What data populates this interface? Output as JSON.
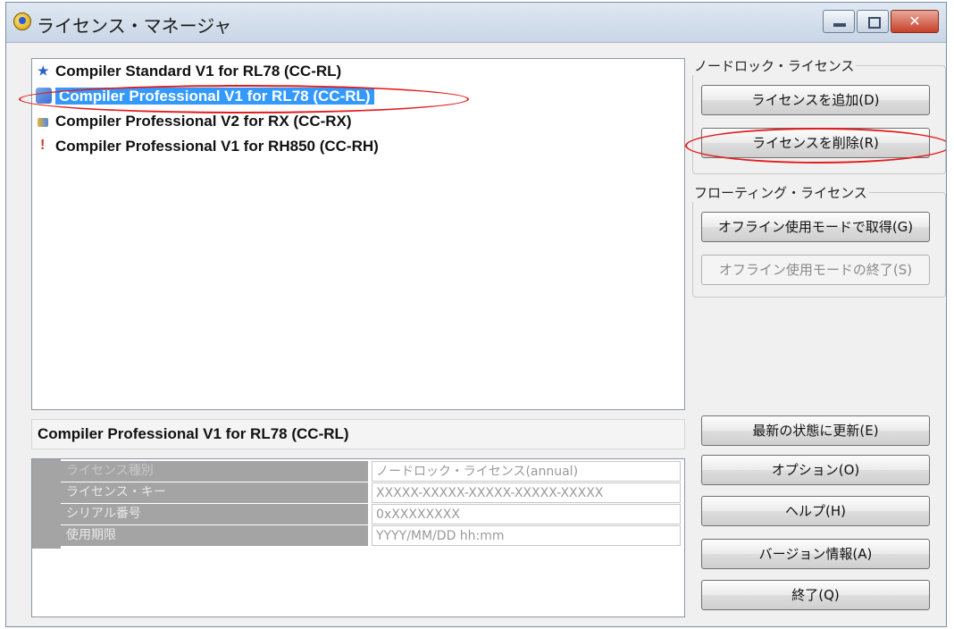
{
  "window": {
    "title": "ライセンス・マネージャ",
    "close_label": "✕"
  },
  "license_list": [
    {
      "label": "Compiler Standard V1 for RL78 (CC-RL)",
      "icon": "star-icon"
    },
    {
      "label": "Compiler Professional V1 for RL78 (CC-RL)",
      "icon": "key-icon",
      "selected": true
    },
    {
      "label": "Compiler Professional V2 for RX (CC-RX)",
      "icon": "license-icon"
    },
    {
      "label": "Compiler Professional V1 for RH850 (CC-RH)",
      "icon": "warning-icon"
    }
  ],
  "node_lock": {
    "group_label": "ノードロック・ライセンス",
    "add_label": "ライセンスを追加(D)",
    "remove_label": "ライセンスを削除(R)"
  },
  "floating": {
    "group_label": "フローティング・ライセンス",
    "offline_acquire_label": "オフライン使用モードで取得(G)",
    "offline_end_label": "オフライン使用モードの終了(S)"
  },
  "buttons": {
    "refresh": "最新の状態に更新(E)",
    "options": "オプション(O)",
    "help": "ヘルプ(H)",
    "version": "バージョン情報(A)",
    "exit": "終了(Q)"
  },
  "detail": {
    "title": "Compiler Professional V1 for RL78 (CC-RL)",
    "properties": [
      {
        "name": "ライセンス種別",
        "value": "ノードロック・ライセンス(annual)"
      },
      {
        "name": "ライセンス・キー",
        "value": "XXXXX-XXXXX-XXXXX-XXXXX-XXXXX"
      },
      {
        "name": "シリアル番号",
        "value": "0xXXXXXXXX"
      },
      {
        "name": "使用期限",
        "value": "YYYY/MM/DD hh:mm"
      }
    ]
  },
  "colors": {
    "selection": "#3399ff",
    "annotation": "#e31c1c"
  }
}
